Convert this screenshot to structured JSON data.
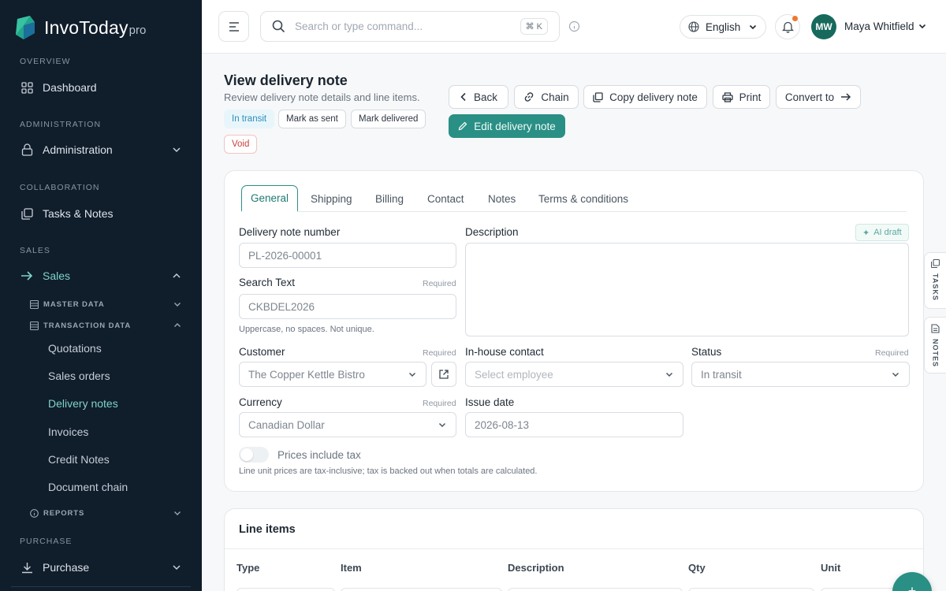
{
  "brand": {
    "name": "InvoToday",
    "suffix": "pro"
  },
  "sidebar": {
    "sections": [
      {
        "label": "OVERVIEW"
      },
      {
        "label": "ADMINISTRATION"
      },
      {
        "label": "COLLABORATION"
      },
      {
        "label": "SALES"
      },
      {
        "label": "PURCHASE"
      }
    ],
    "items": {
      "dashboard": "Dashboard",
      "administration": "Administration",
      "tasks_notes": "Tasks & Notes",
      "sales": "Sales",
      "purchase": "Purchase"
    },
    "sub_groups": {
      "master_data": "MASTER DATA",
      "transaction_data": "TRANSACTION DATA",
      "reports": "REPORTS"
    },
    "sub_items": [
      "Quotations",
      "Sales orders",
      "Delivery notes",
      "Invoices",
      "Credit Notes",
      "Document chain"
    ],
    "active_sub_item": "Delivery notes"
  },
  "topbar": {
    "search_placeholder": "Search or type command...",
    "shortcut": "⌘ K",
    "language": "English",
    "user_initials": "MW",
    "user_name": "Maya Whitfield"
  },
  "header": {
    "title": "View delivery note",
    "subtitle": "Review delivery note details and line items.",
    "status_chip": "In transit",
    "mark_sent": "Mark as sent",
    "mark_delivered": "Mark delivered",
    "void": "Void",
    "buttons": {
      "back": "Back",
      "chain": "Chain",
      "copy": "Copy delivery note",
      "print": "Print",
      "convert": "Convert to",
      "edit": "Edit delivery note"
    }
  },
  "tabs": [
    "General",
    "Shipping",
    "Billing",
    "Contact",
    "Notes",
    "Terms & conditions"
  ],
  "form": {
    "delivery_note_number": {
      "label": "Delivery note number",
      "value": "PL-2026-00001"
    },
    "search_text": {
      "label": "Search Text",
      "required": "Required",
      "value": "CKBDEL2026",
      "hint": "Uppercase, no spaces. Not unique."
    },
    "description": {
      "label": "Description",
      "ai_draft": "AI draft"
    },
    "customer": {
      "label": "Customer",
      "required": "Required",
      "value": "The Copper Kettle Bistro"
    },
    "inhouse_contact": {
      "label": "In-house contact",
      "placeholder": "Select employee"
    },
    "status": {
      "label": "Status",
      "required": "Required",
      "value": "In transit"
    },
    "currency": {
      "label": "Currency",
      "required": "Required",
      "value": "Canadian Dollar"
    },
    "issue_date": {
      "label": "Issue date",
      "value": "2026-08-13"
    },
    "prices_include_tax": {
      "label": "Prices include tax",
      "hint": "Line unit prices are tax-inclusive; tax is backed out when totals are calculated."
    }
  },
  "rail": {
    "tasks": "TASKS",
    "notes": "NOTES"
  },
  "line_items": {
    "title": "Line items",
    "columns": [
      "Type",
      "Item",
      "Description",
      "Qty",
      "Unit"
    ]
  },
  "fab_symbol": "+",
  "colors": {
    "accent": "#2a8f85",
    "sidebar_bg": "#101d2b",
    "active_nav": "#7fd3c8",
    "notification": "#f2762e",
    "void": "#c9403a"
  }
}
